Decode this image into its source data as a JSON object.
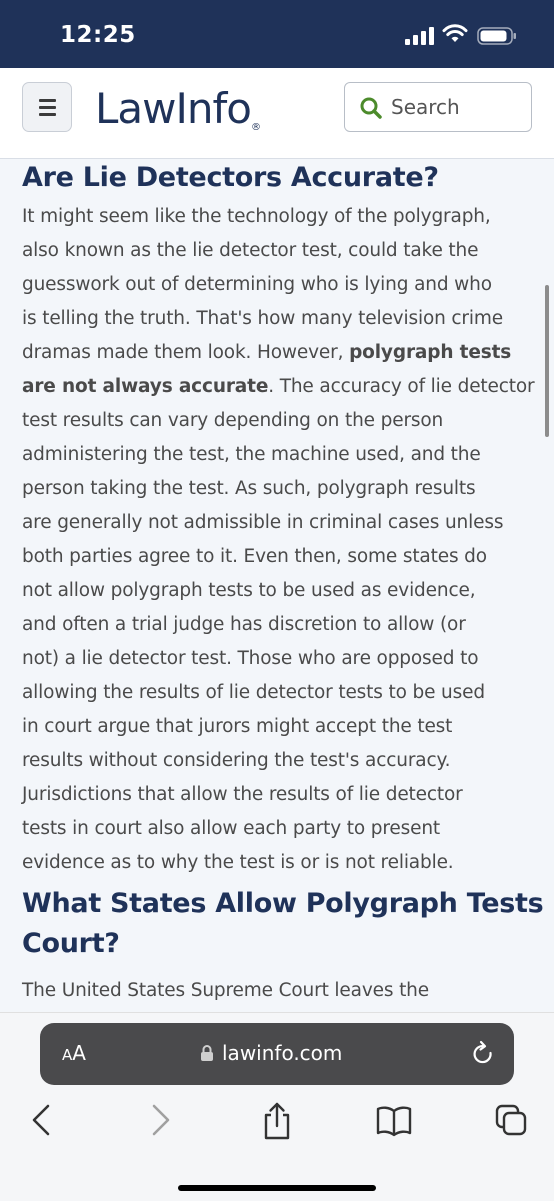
{
  "status_bar": {
    "time": "12:25"
  },
  "header": {
    "logo_part1": "Law",
    "logo_part2": "Info",
    "logo_reg": "®",
    "search_label": "Search"
  },
  "article": {
    "heading1": "Are Lie Detectors Accurate?",
    "para1_lines": [
      "It might seem like the technology of the polygraph,",
      "also known as the lie detector test, could take the",
      "guesswork out of determining who is lying and who",
      "is telling the truth. That's how many television crime",
      "dramas made them look. However, ",
      "polygraph tests",
      "are not always accurate",
      ". The accuracy of lie detector",
      "test results can vary depending on the person",
      "administering the test, the machine used, and the",
      "person taking the test. As such, polygraph results",
      "are generally not admissible in criminal cases unless",
      "both parties agree to it. Even then, some states do",
      "not allow polygraph tests to be used as evidence,",
      "and often a trial judge has discretion to allow (or",
      "not) a lie detector test. Those who are opposed to",
      "allowing the results of lie detector tests to be used",
      "in court argue that jurors might accept the test",
      "results without considering the test's accuracy.",
      "Jurisdictions that allow the results of lie detector",
      "tests in court also allow each party to present",
      "evidence as to why the test is or is not reliable."
    ],
    "heading2_line1": "What States Allow Polygraph Tests in",
    "heading2_line2": "Court?",
    "para2_line1": "The United States Supreme Court leaves the"
  },
  "browser": {
    "aa_label_small": "A",
    "aa_label_big": "A",
    "url": "lawinfo.com"
  },
  "colors": {
    "brand_navy": "#1f3259",
    "search_green": "#4c8b2b",
    "text_gray": "#4a4a4a"
  }
}
